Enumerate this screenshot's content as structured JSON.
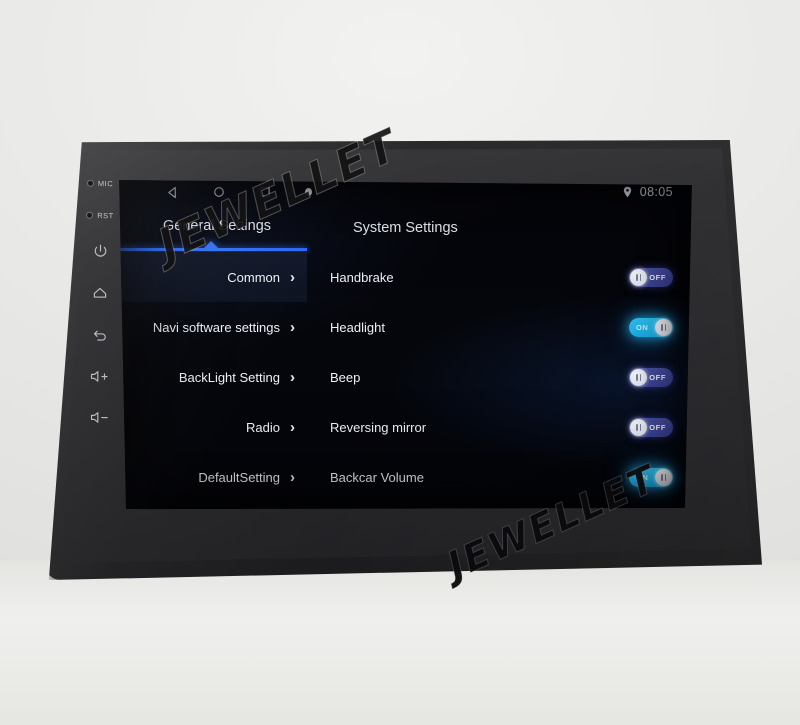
{
  "device": {
    "hardware_keys": [
      {
        "name": "mic-indicator",
        "label": "MIC",
        "type": "led"
      },
      {
        "name": "reset-indicator",
        "label": "RST",
        "type": "led"
      },
      {
        "name": "power-button",
        "label": "",
        "type": "power-icon"
      },
      {
        "name": "home-button",
        "label": "",
        "type": "home-icon"
      },
      {
        "name": "back-button",
        "label": "",
        "type": "back-icon"
      },
      {
        "name": "volume-up-button",
        "label": "+",
        "type": "volume-up-icon"
      },
      {
        "name": "volume-down-button",
        "label": "−",
        "type": "volume-down-icon"
      }
    ]
  },
  "statusbar": {
    "back_icon": "triangle-left-icon",
    "home_icon": "circle-icon",
    "recents_icon": "square-icon",
    "dot_icon": "dot-icon",
    "location_icon": "location-pin-icon",
    "time": "08:05"
  },
  "tabs": [
    {
      "label": "General Settings",
      "active": true
    },
    {
      "label": "System Settings",
      "active": false
    }
  ],
  "left_menu": {
    "items": [
      {
        "label": "Common",
        "chevron": "›",
        "active": true
      },
      {
        "label": "Navi software settings",
        "chevron": "›",
        "active": false
      },
      {
        "label": "BackLight Setting",
        "chevron": "›",
        "active": false
      },
      {
        "label": "Radio",
        "chevron": "›",
        "active": false
      },
      {
        "label": "DefaultSetting",
        "chevron": "›",
        "active": false
      }
    ]
  },
  "system_settings": {
    "items": [
      {
        "label": "Handbrake",
        "state": "OFF",
        "on": false
      },
      {
        "label": "Headlight",
        "state": "ON",
        "on": true
      },
      {
        "label": "Beep",
        "state": "OFF",
        "on": false
      },
      {
        "label": "Reversing mirror",
        "state": "OFF",
        "on": false
      },
      {
        "label": "Backcar Volume",
        "state": "ON",
        "on": true
      }
    ]
  },
  "watermark": {
    "text_top": "JEWELLET",
    "text_bottom": "JEWELLET"
  },
  "colors": {
    "accent_blue": "#3a79ff",
    "toggle_on": "#19b4ef",
    "toggle_off": "#3d459a",
    "screen_bg": "#04050a",
    "bezel": "#232325",
    "backdrop": "#ececeb"
  }
}
